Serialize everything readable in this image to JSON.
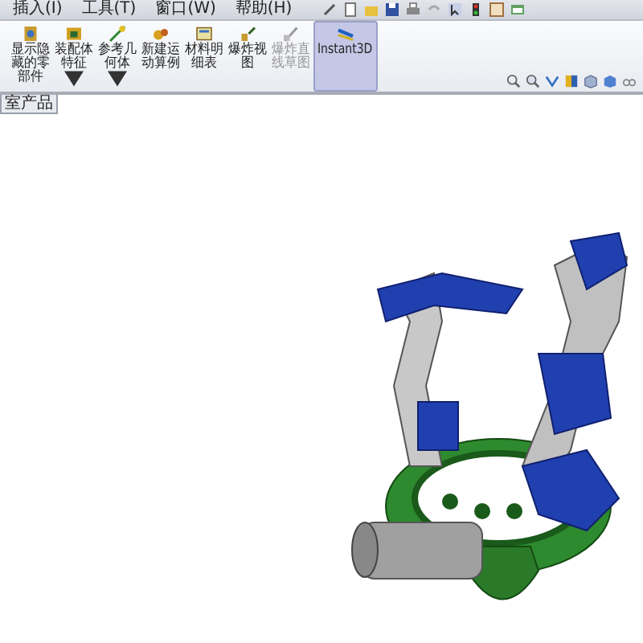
{
  "menu_bar": {
    "items": [
      "插入(I)",
      "工具(T)",
      "窗口(W)",
      "帮助(H)"
    ]
  },
  "toolbar": {
    "buttons": [
      {
        "label": "显示隐藏的零部件",
        "dropdown": false,
        "disabled": false,
        "selected": false
      },
      {
        "label": "装配体特征",
        "dropdown": true,
        "disabled": false,
        "selected": false
      },
      {
        "label": "参考几何体",
        "dropdown": true,
        "disabled": false,
        "selected": false
      },
      {
        "label": "新建运动算例",
        "dropdown": false,
        "disabled": false,
        "selected": false
      },
      {
        "label": "材料明细表",
        "dropdown": false,
        "disabled": false,
        "selected": false
      },
      {
        "label": "爆炸视图",
        "dropdown": false,
        "disabled": false,
        "selected": false
      },
      {
        "label": "爆炸直线草图",
        "dropdown": false,
        "disabled": true,
        "selected": false
      },
      {
        "label": "Instant3D",
        "dropdown": false,
        "disabled": false,
        "selected": true
      }
    ]
  },
  "tabs": [
    {
      "label": "室产品"
    }
  ]
}
